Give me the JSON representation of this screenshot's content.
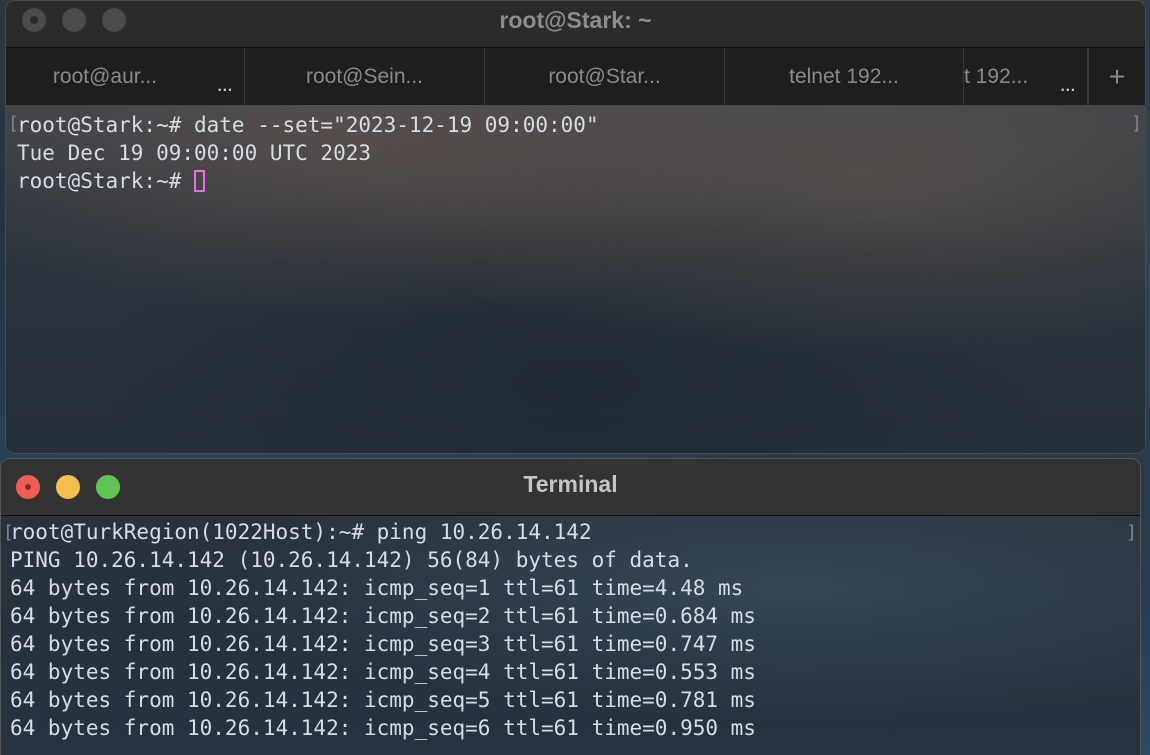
{
  "window_back": {
    "title": "root@Stark: ~",
    "tabs": [
      {
        "label": "root@aur..."
      },
      {
        "label": "root@Sein..."
      },
      {
        "label": "root@Star..."
      },
      {
        "label": "telnet 192..."
      },
      {
        "label": "t 192..."
      }
    ],
    "tab_overflow_label": "...",
    "new_tab_label": "+",
    "lines": [
      "root@Stark:~# date --set=\"2023-12-19 09:00:00\"",
      "Tue Dec 19 09:00:00 UTC 2023"
    ],
    "prompt": "root@Stark:~# "
  },
  "window_front": {
    "title": "Terminal",
    "lines": [
      "root@TurkRegion(1022Host):~# ping 10.26.14.142",
      "PING 10.26.14.142 (10.26.14.142) 56(84) bytes of data.",
      "64 bytes from 10.26.14.142: icmp_seq=1 ttl=61 time=4.48 ms",
      "64 bytes from 10.26.14.142: icmp_seq=2 ttl=61 time=0.684 ms",
      "64 bytes from 10.26.14.142: icmp_seq=3 ttl=61 time=0.747 ms",
      "64 bytes from 10.26.14.142: icmp_seq=4 ttl=61 time=0.553 ms",
      "64 bytes from 10.26.14.142: icmp_seq=5 ttl=61 time=0.781 ms",
      "64 bytes from 10.26.14.142: icmp_seq=6 ttl=61 time=0.950 ms"
    ]
  },
  "colors": {
    "terminal_text": "#d5dde6",
    "cursor": "#e66fe6",
    "close": "#ed5f56",
    "minimize": "#f5be4f",
    "zoom": "#5fc454"
  }
}
